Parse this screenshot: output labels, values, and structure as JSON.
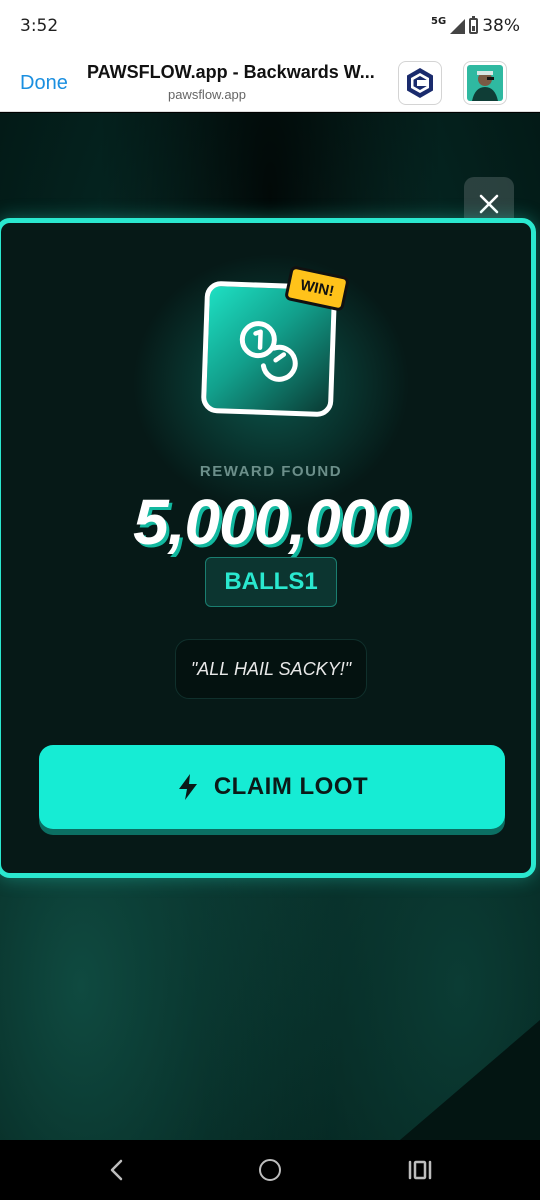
{
  "status_bar": {
    "time": "3:52",
    "network": "5G",
    "battery": "38%",
    "battery_level": 0.38
  },
  "browser": {
    "done_label": "Done",
    "title": "PAWSFLOW.app - Backwards W...",
    "url": "pawsflow.app",
    "extensions": [
      "c-logo-icon",
      "avatar-icon"
    ]
  },
  "modal": {
    "badge": "WIN!",
    "reward_label": "REWARD FOUND",
    "amount": "5,000,000",
    "token": "BALLS1",
    "quote": "\"ALL HAIL SACKY!\"",
    "claim_label": "CLAIM LOOT"
  },
  "colors": {
    "accent": "#2ae8cf",
    "button": "#16ecd4",
    "badge": "#ffc21a",
    "link": "#1a8fe0"
  },
  "navigation": [
    "back-icon",
    "home-icon",
    "recent-apps-icon"
  ]
}
